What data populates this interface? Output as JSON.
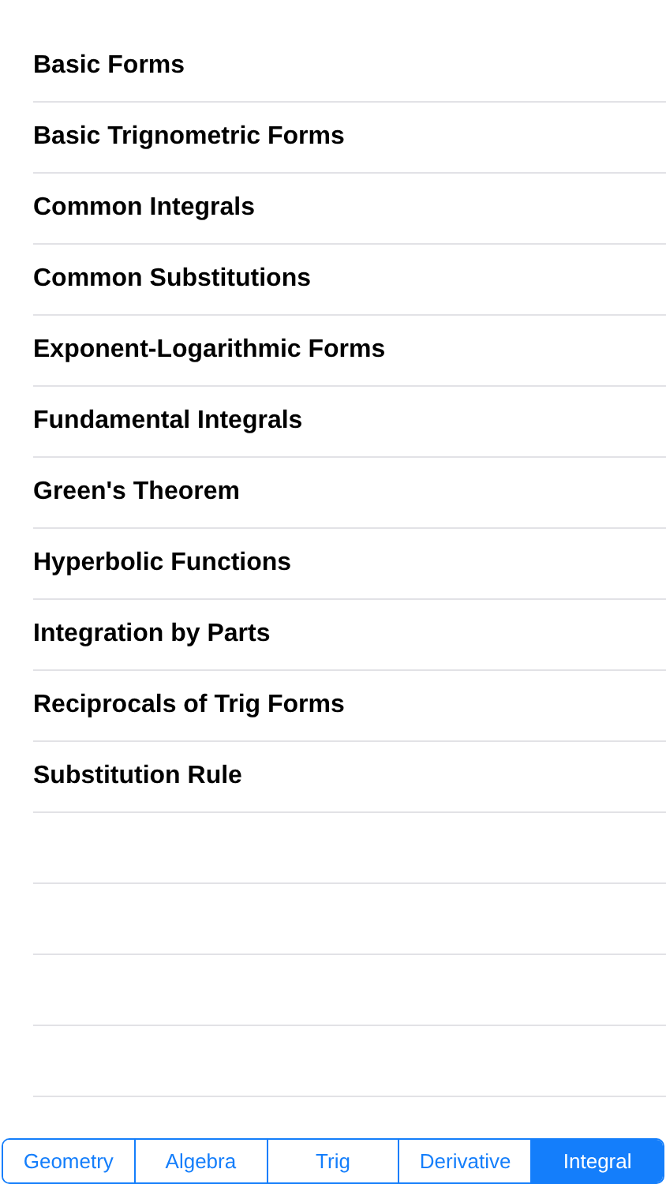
{
  "list": {
    "items": [
      {
        "label": "Basic Forms"
      },
      {
        "label": "Basic Trignometric Forms"
      },
      {
        "label": "Common Integrals"
      },
      {
        "label": "Common Substitutions"
      },
      {
        "label": "Exponent-Logarithmic Forms"
      },
      {
        "label": "Fundamental Integrals"
      },
      {
        "label": "Green's Theorem"
      },
      {
        "label": "Hyperbolic Functions"
      },
      {
        "label": "Integration by Parts"
      },
      {
        "label": "Reciprocals of Trig Forms"
      },
      {
        "label": "Substitution Rule"
      }
    ]
  },
  "segments": [
    {
      "label": "Geometry",
      "selected": false
    },
    {
      "label": "Algebra",
      "selected": false
    },
    {
      "label": "Trig",
      "selected": false
    },
    {
      "label": "Derivative",
      "selected": false
    },
    {
      "label": "Integral",
      "selected": true
    }
  ]
}
